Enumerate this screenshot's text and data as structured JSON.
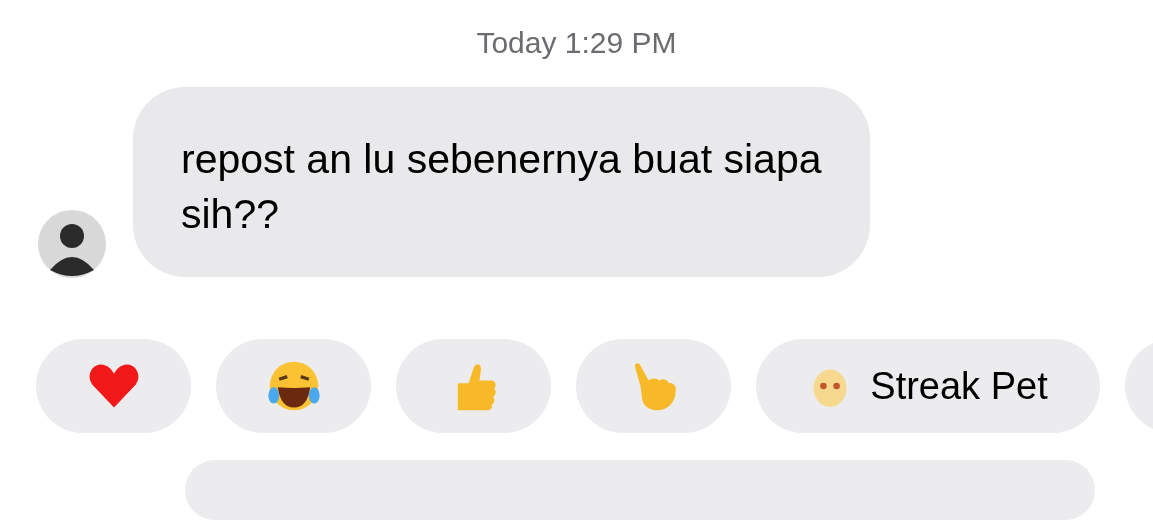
{
  "timestamp": "Today 1:29 PM",
  "message": {
    "text": "repost an lu sebenernya buat siapa sih??"
  },
  "quick_replies": [
    {
      "kind": "heart"
    },
    {
      "kind": "laugh"
    },
    {
      "kind": "thumbs-up"
    },
    {
      "kind": "point"
    },
    {
      "kind": "pet",
      "label": "Streak Pet"
    },
    {
      "kind": "blank"
    }
  ]
}
